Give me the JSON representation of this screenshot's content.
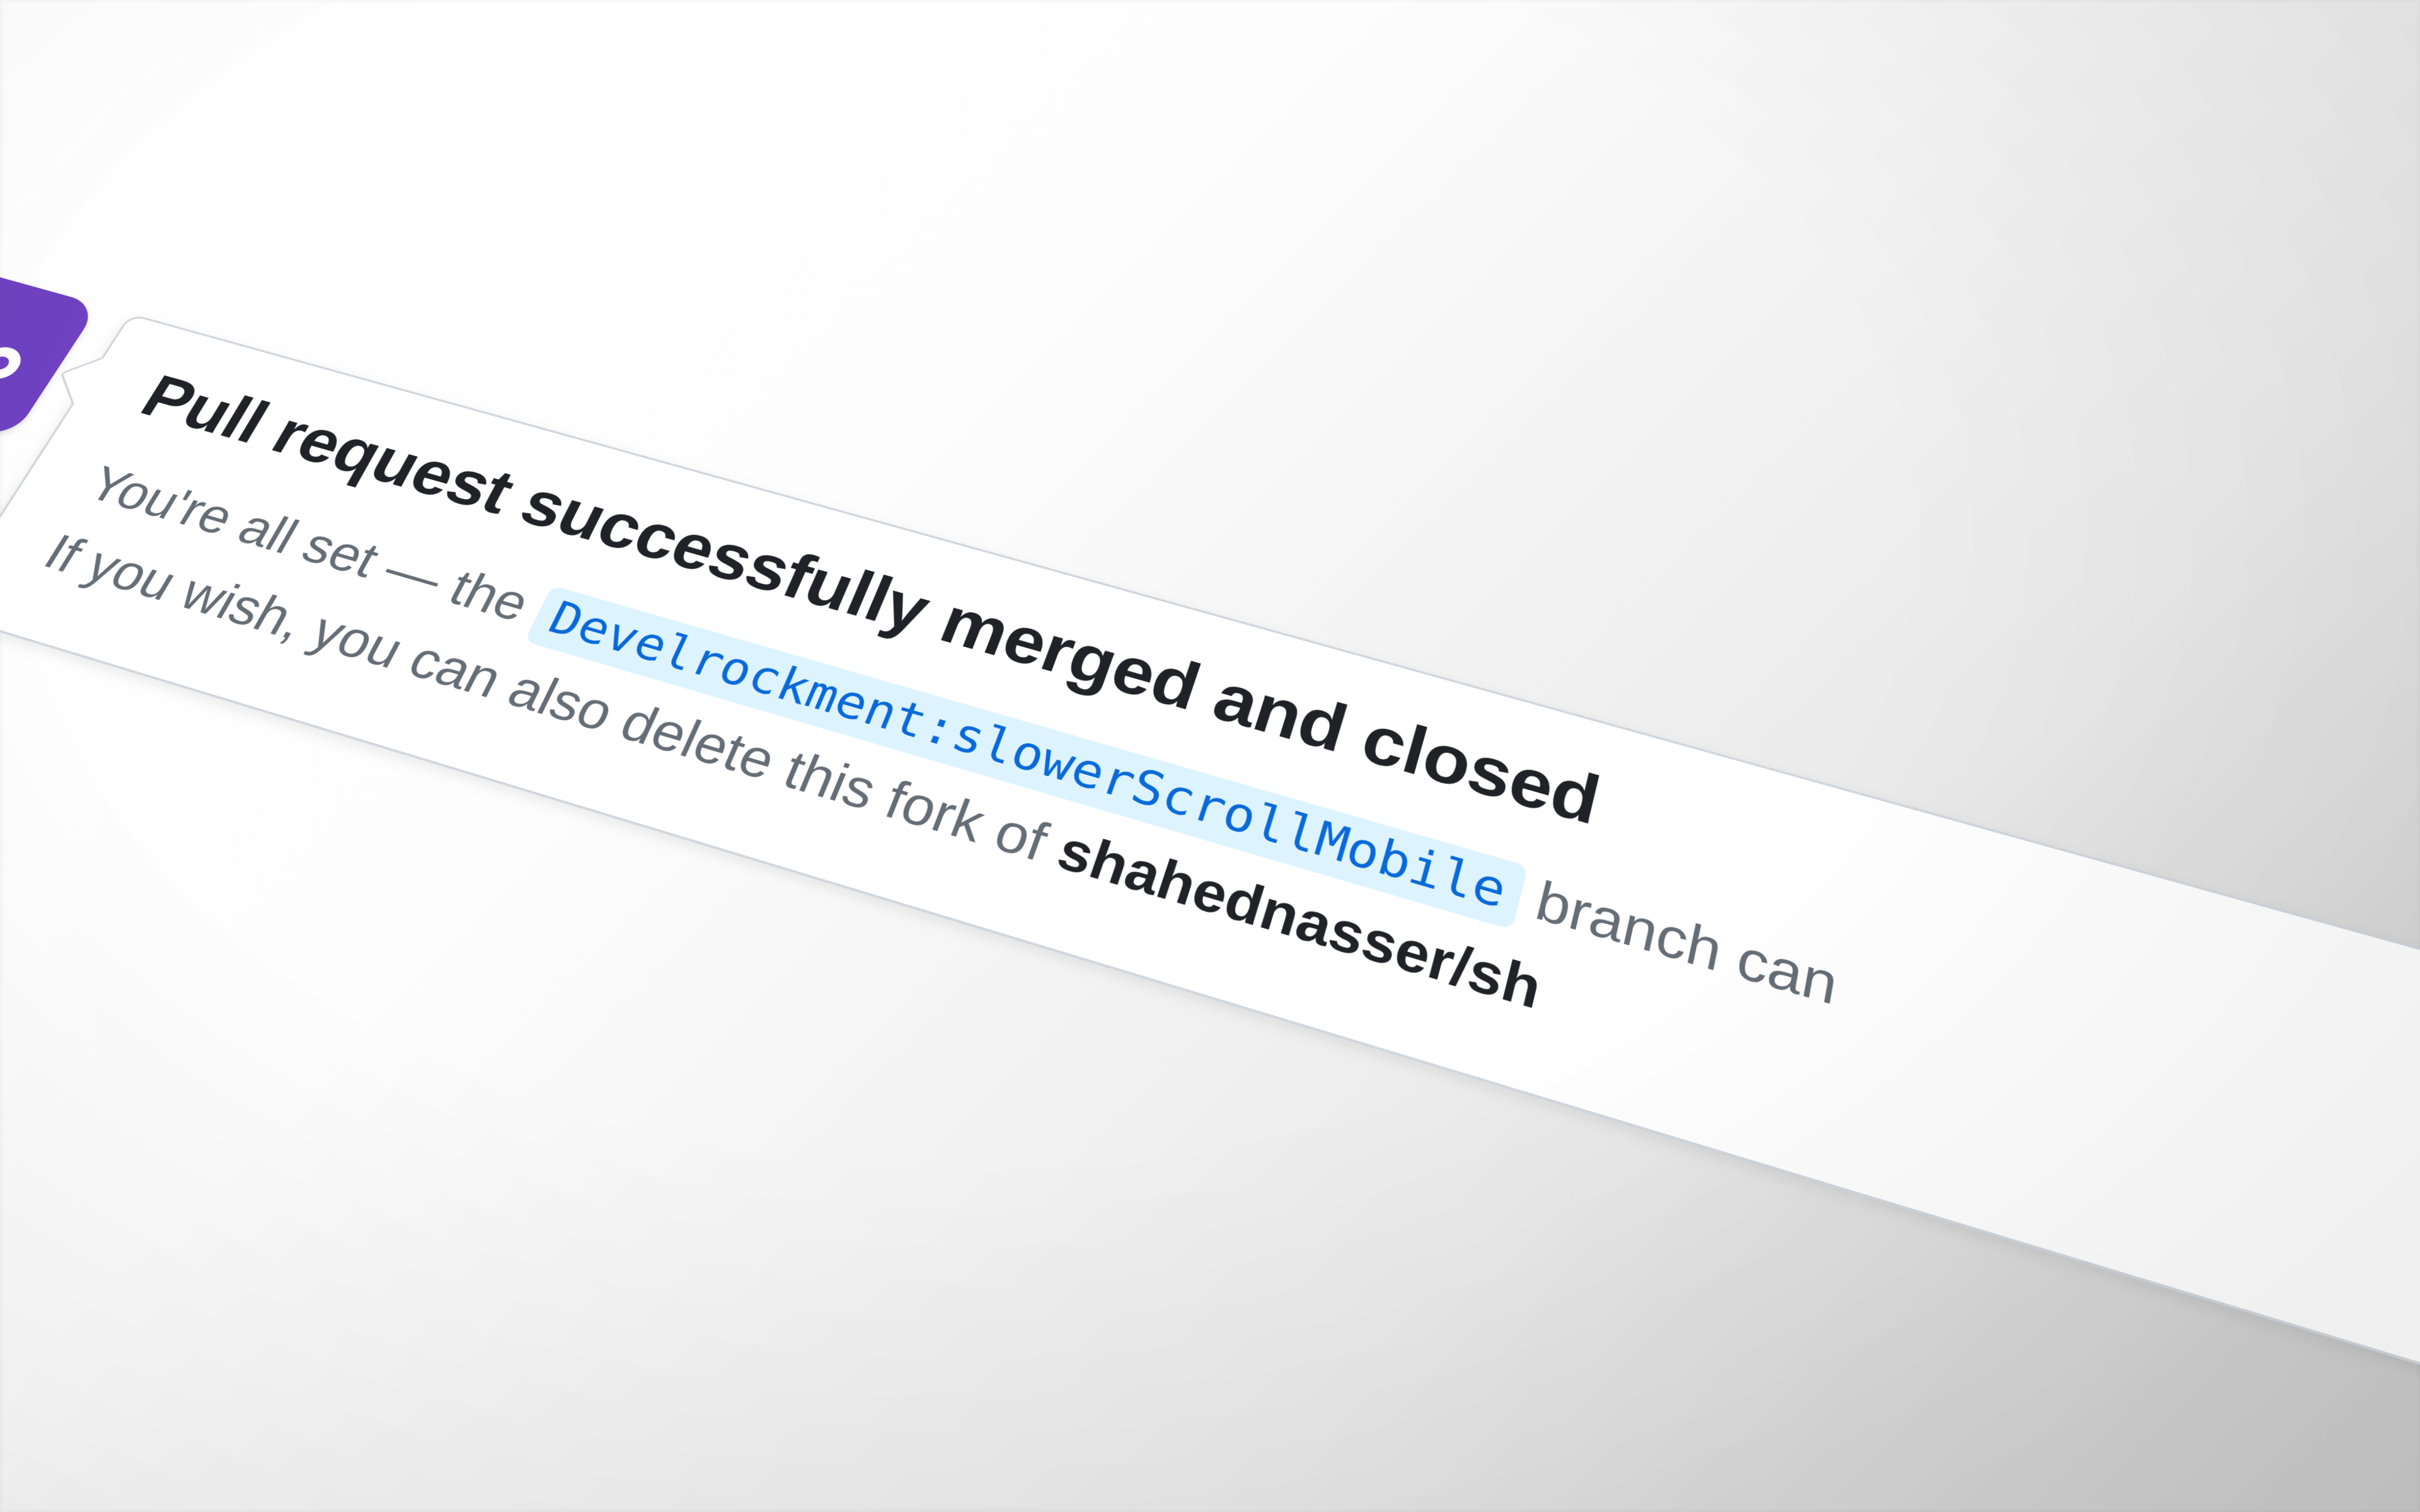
{
  "colors": {
    "accent": "#6f42c1",
    "link": "#0969da"
  },
  "merge": {
    "icon": "git-merge-icon",
    "title": "Pull request successfully merged and closed",
    "line1_prefix": "You're all set — the ",
    "branch": "Develrockment:slowerScrollMobile",
    "line1_suffix": " branch can",
    "line2_prefix": "If you wish, you can also delete this fork of ",
    "repo": "shahednasser/sh"
  }
}
